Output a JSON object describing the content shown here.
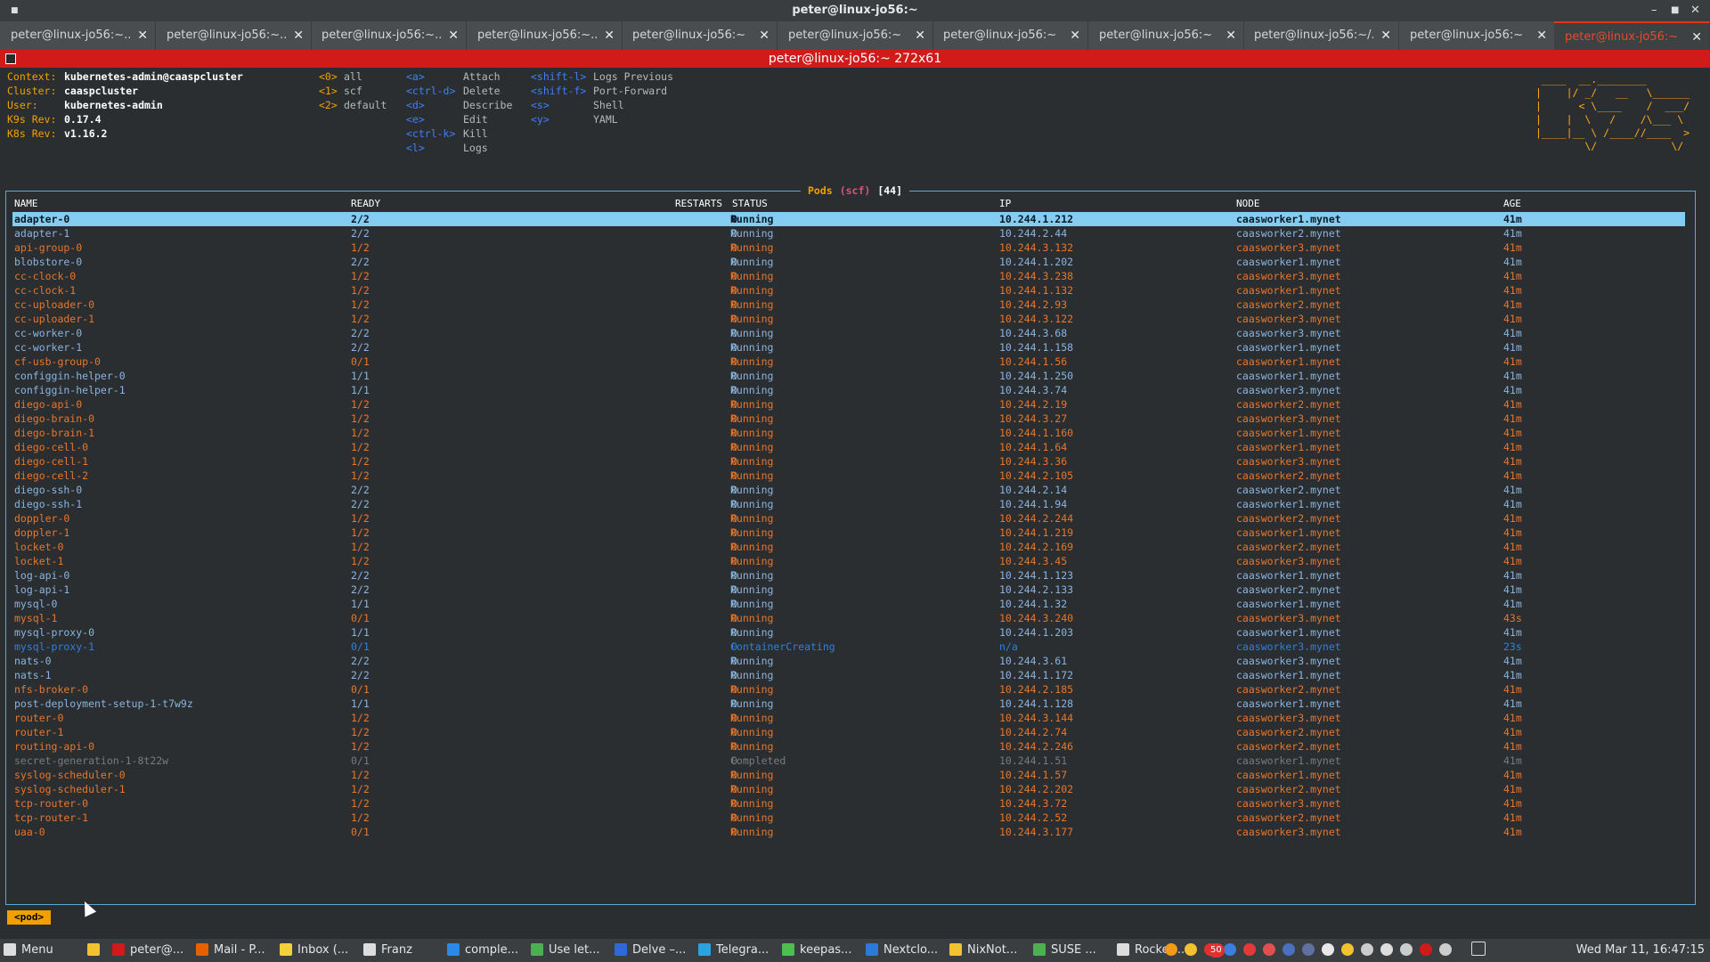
{
  "window": {
    "title": "peter@linux-jo56:~",
    "btn_min": "▪",
    "btn_max": "▪",
    "btn_close": "✕"
  },
  "tabs": [
    {
      "label": "peter@linux-jo56:~..."
    },
    {
      "label": "peter@linux-jo56:~..."
    },
    {
      "label": "peter@linux-jo56:~..."
    },
    {
      "label": "peter@linux-jo56:~..."
    },
    {
      "label": "peter@linux-jo56:~"
    },
    {
      "label": "peter@linux-jo56:~"
    },
    {
      "label": "peter@linux-jo56:~"
    },
    {
      "label": "peter@linux-jo56:~"
    },
    {
      "label": "peter@linux-jo56:~/..."
    },
    {
      "label": "peter@linux-jo56:~"
    },
    {
      "label": "peter@linux-jo56:~",
      "active": true
    }
  ],
  "terminal": {
    "title": "peter@linux-jo56:~ 272x61"
  },
  "info": {
    "context_label": "Context:",
    "context_value": "kubernetes-admin@caaspcluster",
    "cluster_label": "Cluster:",
    "cluster_value": "caaspcluster",
    "user_label": "User:",
    "user_value": "kubernetes-admin",
    "k9s_label": "K9s Rev:",
    "k9s_value": "0.17.4",
    "k8s_label": "K8s Rev:",
    "k8s_value": "v1.16.2"
  },
  "namespaces": [
    {
      "key": "<0>",
      "name": "all"
    },
    {
      "key": "<1>",
      "name": "scf"
    },
    {
      "key": "<2>",
      "name": "default"
    }
  ],
  "shortcuts_a": [
    {
      "key": "<a>",
      "action": "Attach"
    },
    {
      "key": "<ctrl-d>",
      "action": "Delete"
    },
    {
      "key": "<d>",
      "action": "Describe"
    },
    {
      "key": "<e>",
      "action": "Edit"
    },
    {
      "key": "<ctrl-k>",
      "action": "Kill"
    },
    {
      "key": "<l>",
      "action": "Logs"
    }
  ],
  "shortcuts_b": [
    {
      "key": "<shift-l>",
      "action": "Logs Previous"
    },
    {
      "key": "<shift-f>",
      "action": "Port-Forward"
    },
    {
      "key": "<s>",
      "action": "Shell"
    },
    {
      "key": "<y>",
      "action": "YAML"
    }
  ],
  "logo": " ____  __.________        \n|    |/ _/   __   \\______ \n|      < \\____    /  ___/ \n|    |  \\   /    /\\___ \\  \n|____|__ \\ /____//____  > \n        \\/            \\/  ",
  "pods": {
    "title": "Pods",
    "scope": "(scf)",
    "count": "[44]",
    "columns": {
      "name": "NAME",
      "ready": "READY",
      "restarts": "RESTARTS",
      "status": "STATUS",
      "ip": "IP",
      "node": "NODE",
      "age": "AGE"
    },
    "rows": [
      {
        "name": "adapter-0",
        "ready": "2/2",
        "restarts": "0",
        "status": "Running",
        "ip": "10.244.1.212",
        "node": "caasworker1.mynet",
        "age": "41m",
        "state": "selected"
      },
      {
        "name": "adapter-1",
        "ready": "2/2",
        "restarts": "0",
        "status": "Running",
        "ip": "10.244.2.44",
        "node": "caasworker2.mynet",
        "age": "41m",
        "state": "ok"
      },
      {
        "name": "api-group-0",
        "ready": "1/2",
        "restarts": "0",
        "status": "Running",
        "ip": "10.244.3.132",
        "node": "caasworker3.mynet",
        "age": "41m",
        "state": "warn"
      },
      {
        "name": "blobstore-0",
        "ready": "2/2",
        "restarts": "0",
        "status": "Running",
        "ip": "10.244.1.202",
        "node": "caasworker1.mynet",
        "age": "41m",
        "state": "ok"
      },
      {
        "name": "cc-clock-0",
        "ready": "1/2",
        "restarts": "0",
        "status": "Running",
        "ip": "10.244.3.238",
        "node": "caasworker3.mynet",
        "age": "41m",
        "state": "warn"
      },
      {
        "name": "cc-clock-1",
        "ready": "1/2",
        "restarts": "0",
        "status": "Running",
        "ip": "10.244.1.132",
        "node": "caasworker1.mynet",
        "age": "41m",
        "state": "warn"
      },
      {
        "name": "cc-uploader-0",
        "ready": "1/2",
        "restarts": "0",
        "status": "Running",
        "ip": "10.244.2.93",
        "node": "caasworker2.mynet",
        "age": "41m",
        "state": "warn"
      },
      {
        "name": "cc-uploader-1",
        "ready": "1/2",
        "restarts": "0",
        "status": "Running",
        "ip": "10.244.3.122",
        "node": "caasworker3.mynet",
        "age": "41m",
        "state": "warn"
      },
      {
        "name": "cc-worker-0",
        "ready": "2/2",
        "restarts": "0",
        "status": "Running",
        "ip": "10.244.3.68",
        "node": "caasworker3.mynet",
        "age": "41m",
        "state": "ok"
      },
      {
        "name": "cc-worker-1",
        "ready": "2/2",
        "restarts": "0",
        "status": "Running",
        "ip": "10.244.1.158",
        "node": "caasworker1.mynet",
        "age": "41m",
        "state": "ok"
      },
      {
        "name": "cf-usb-group-0",
        "ready": "0/1",
        "restarts": "0",
        "status": "Running",
        "ip": "10.244.1.56",
        "node": "caasworker1.mynet",
        "age": "41m",
        "state": "warn"
      },
      {
        "name": "configgin-helper-0",
        "ready": "1/1",
        "restarts": "0",
        "status": "Running",
        "ip": "10.244.1.250",
        "node": "caasworker1.mynet",
        "age": "41m",
        "state": "ok"
      },
      {
        "name": "configgin-helper-1",
        "ready": "1/1",
        "restarts": "0",
        "status": "Running",
        "ip": "10.244.3.74",
        "node": "caasworker3.mynet",
        "age": "41m",
        "state": "ok"
      },
      {
        "name": "diego-api-0",
        "ready": "1/2",
        "restarts": "0",
        "status": "Running",
        "ip": "10.244.2.19",
        "node": "caasworker2.mynet",
        "age": "41m",
        "state": "warn"
      },
      {
        "name": "diego-brain-0",
        "ready": "1/2",
        "restarts": "0",
        "status": "Running",
        "ip": "10.244.3.27",
        "node": "caasworker3.mynet",
        "age": "41m",
        "state": "warn"
      },
      {
        "name": "diego-brain-1",
        "ready": "1/2",
        "restarts": "0",
        "status": "Running",
        "ip": "10.244.1.160",
        "node": "caasworker1.mynet",
        "age": "41m",
        "state": "warn"
      },
      {
        "name": "diego-cell-0",
        "ready": "1/2",
        "restarts": "0",
        "status": "Running",
        "ip": "10.244.1.64",
        "node": "caasworker1.mynet",
        "age": "41m",
        "state": "warn"
      },
      {
        "name": "diego-cell-1",
        "ready": "1/2",
        "restarts": "0",
        "status": "Running",
        "ip": "10.244.3.36",
        "node": "caasworker3.mynet",
        "age": "41m",
        "state": "warn"
      },
      {
        "name": "diego-cell-2",
        "ready": "1/2",
        "restarts": "0",
        "status": "Running",
        "ip": "10.244.2.105",
        "node": "caasworker2.mynet",
        "age": "41m",
        "state": "warn"
      },
      {
        "name": "diego-ssh-0",
        "ready": "2/2",
        "restarts": "0",
        "status": "Running",
        "ip": "10.244.2.14",
        "node": "caasworker2.mynet",
        "age": "41m",
        "state": "ok"
      },
      {
        "name": "diego-ssh-1",
        "ready": "2/2",
        "restarts": "0",
        "status": "Running",
        "ip": "10.244.1.94",
        "node": "caasworker1.mynet",
        "age": "41m",
        "state": "ok"
      },
      {
        "name": "doppler-0",
        "ready": "1/2",
        "restarts": "0",
        "status": "Running",
        "ip": "10.244.2.244",
        "node": "caasworker2.mynet",
        "age": "41m",
        "state": "warn"
      },
      {
        "name": "doppler-1",
        "ready": "1/2",
        "restarts": "0",
        "status": "Running",
        "ip": "10.244.1.219",
        "node": "caasworker1.mynet",
        "age": "41m",
        "state": "warn"
      },
      {
        "name": "locket-0",
        "ready": "1/2",
        "restarts": "0",
        "status": "Running",
        "ip": "10.244.2.169",
        "node": "caasworker2.mynet",
        "age": "41m",
        "state": "warn"
      },
      {
        "name": "locket-1",
        "ready": "1/2",
        "restarts": "0",
        "status": "Running",
        "ip": "10.244.3.45",
        "node": "caasworker3.mynet",
        "age": "41m",
        "state": "warn"
      },
      {
        "name": "log-api-0",
        "ready": "2/2",
        "restarts": "0",
        "status": "Running",
        "ip": "10.244.1.123",
        "node": "caasworker1.mynet",
        "age": "41m",
        "state": "ok"
      },
      {
        "name": "log-api-1",
        "ready": "2/2",
        "restarts": "0",
        "status": "Running",
        "ip": "10.244.2.133",
        "node": "caasworker2.mynet",
        "age": "41m",
        "state": "ok"
      },
      {
        "name": "mysql-0",
        "ready": "1/1",
        "restarts": "0",
        "status": "Running",
        "ip": "10.244.1.32",
        "node": "caasworker1.mynet",
        "age": "41m",
        "state": "ok"
      },
      {
        "name": "mysql-1",
        "ready": "0/1",
        "restarts": "0",
        "status": "Running",
        "ip": "10.244.3.240",
        "node": "caasworker3.mynet",
        "age": "43s",
        "state": "warn"
      },
      {
        "name": "mysql-proxy-0",
        "ready": "1/1",
        "restarts": "0",
        "status": "Running",
        "ip": "10.244.1.203",
        "node": "caasworker1.mynet",
        "age": "41m",
        "state": "ok"
      },
      {
        "name": "mysql-proxy-1",
        "ready": "0/1",
        "restarts": "0",
        "status": "ContainerCreating",
        "ip": "n/a",
        "node": "caasworker3.mynet",
        "age": "23s",
        "state": "pending"
      },
      {
        "name": "nats-0",
        "ready": "2/2",
        "restarts": "0",
        "status": "Running",
        "ip": "10.244.3.61",
        "node": "caasworker3.mynet",
        "age": "41m",
        "state": "ok"
      },
      {
        "name": "nats-1",
        "ready": "2/2",
        "restarts": "0",
        "status": "Running",
        "ip": "10.244.1.172",
        "node": "caasworker1.mynet",
        "age": "41m",
        "state": "ok"
      },
      {
        "name": "nfs-broker-0",
        "ready": "0/1",
        "restarts": "0",
        "status": "Running",
        "ip": "10.244.2.185",
        "node": "caasworker2.mynet",
        "age": "41m",
        "state": "warn"
      },
      {
        "name": "post-deployment-setup-1-t7w9z",
        "ready": "1/1",
        "restarts": "0",
        "status": "Running",
        "ip": "10.244.1.128",
        "node": "caasworker1.mynet",
        "age": "41m",
        "state": "ok"
      },
      {
        "name": "router-0",
        "ready": "1/2",
        "restarts": "0",
        "status": "Running",
        "ip": "10.244.3.144",
        "node": "caasworker3.mynet",
        "age": "41m",
        "state": "warn"
      },
      {
        "name": "router-1",
        "ready": "1/2",
        "restarts": "0",
        "status": "Running",
        "ip": "10.244.2.74",
        "node": "caasworker2.mynet",
        "age": "41m",
        "state": "warn"
      },
      {
        "name": "routing-api-0",
        "ready": "1/2",
        "restarts": "0",
        "status": "Running",
        "ip": "10.244.2.246",
        "node": "caasworker2.mynet",
        "age": "41m",
        "state": "warn"
      },
      {
        "name": "secret-generation-1-8t22w",
        "ready": "0/1",
        "restarts": "0",
        "status": "Completed",
        "ip": "10.244.1.51",
        "node": "caasworker1.mynet",
        "age": "41m",
        "state": "completed"
      },
      {
        "name": "syslog-scheduler-0",
        "ready": "1/2",
        "restarts": "0",
        "status": "Running",
        "ip": "10.244.1.57",
        "node": "caasworker1.mynet",
        "age": "41m",
        "state": "warn"
      },
      {
        "name": "syslog-scheduler-1",
        "ready": "1/2",
        "restarts": "0",
        "status": "Running",
        "ip": "10.244.2.202",
        "node": "caasworker2.mynet",
        "age": "41m",
        "state": "warn"
      },
      {
        "name": "tcp-router-0",
        "ready": "1/2",
        "restarts": "0",
        "status": "Running",
        "ip": "10.244.3.72",
        "node": "caasworker3.mynet",
        "age": "41m",
        "state": "warn"
      },
      {
        "name": "tcp-router-1",
        "ready": "1/2",
        "restarts": "0",
        "status": "Running",
        "ip": "10.244.2.52",
        "node": "caasworker2.mynet",
        "age": "41m",
        "state": "warn"
      },
      {
        "name": "uaa-0",
        "ready": "0/1",
        "restarts": "0",
        "status": "Running",
        "ip": "10.244.3.177",
        "node": "caasworker3.mynet",
        "age": "41m",
        "state": "warn"
      }
    ]
  },
  "state_colors": {
    "ok": "#8ab4e0",
    "warn": "#e8762b",
    "pending": "#2f7fe0",
    "completed": "#7a7a7a",
    "selected": "#0b1a28"
  },
  "crumb": "<pod>",
  "taskbar": {
    "items": [
      {
        "label": "Menu",
        "icon": "menu-icon",
        "color": "#dddddd"
      },
      {
        "label": "",
        "icon": "folder-icon",
        "color": "#f2c230"
      },
      {
        "label": "peter@...",
        "icon": "terminal-icon",
        "color": "#d11a1a"
      },
      {
        "label": "Mail - P...",
        "icon": "firefox-icon",
        "color": "#e66000"
      },
      {
        "label": "Inbox (...",
        "icon": "mail-icon",
        "color": "#f2d13a"
      },
      {
        "label": "Franz",
        "icon": "window-icon",
        "color": "#dddddd"
      },
      {
        "label": "comple...",
        "icon": "vscode-icon",
        "color": "#2b8ae8"
      },
      {
        "label": "Use let...",
        "icon": "chrome-icon",
        "color": "#4caf50"
      },
      {
        "label": "Delve –...",
        "icon": "delve-icon",
        "color": "#2b6ad8"
      },
      {
        "label": "Telegra...",
        "icon": "telegram-icon",
        "color": "#2aa3e0"
      },
      {
        "label": "keepas...",
        "icon": "keepass-icon",
        "color": "#4cbf50"
      },
      {
        "label": "Nextclo...",
        "icon": "nextcloud-icon",
        "color": "#2b7ad8"
      },
      {
        "label": "NixNot...",
        "icon": "note-icon",
        "color": "#f2c230"
      },
      {
        "label": "SUSE ...",
        "icon": "chrome-icon",
        "color": "#4caf50"
      },
      {
        "label": "Rocket....",
        "icon": "window-icon",
        "color": "#dddddd"
      }
    ],
    "tray_badge": "50",
    "clock": "Wed Mar 11, 16:47:15"
  }
}
